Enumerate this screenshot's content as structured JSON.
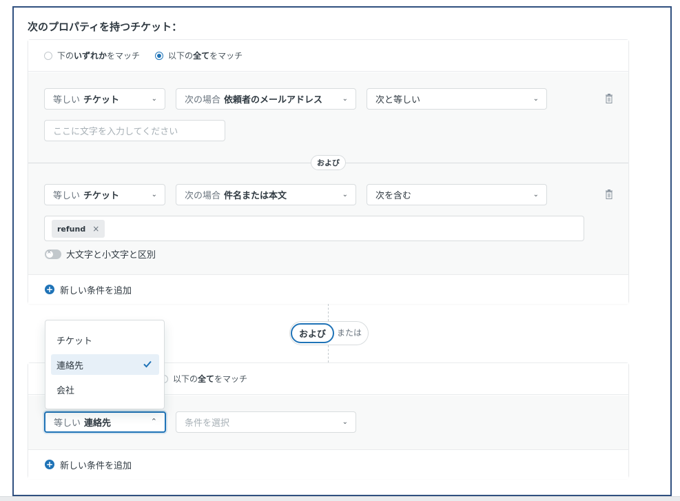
{
  "title": "次のプロパティを持つチケット：",
  "match": {
    "any_prefix": "下の",
    "any_bold": "いずれか",
    "any_suffix": "をマッチ",
    "all_prefix": "以下の",
    "all_bold": "全て",
    "all_suffix": "をマッチ",
    "selected": "all"
  },
  "group1": {
    "conditions": [
      {
        "type_prefix": "等しい",
        "type_value": "チケット",
        "field_prefix": "次の場合",
        "field_value": "依頼者のメールアドレス",
        "operator": "次と等しい",
        "input_placeholder": "ここに文字を入力してください"
      },
      {
        "type_prefix": "等しい",
        "type_value": "チケット",
        "field_prefix": "次の場合",
        "field_value": "件名または本文",
        "operator": "次を含む",
        "tags": [
          "refund"
        ],
        "case_toggle_label": "大文字と小文字と区別",
        "case_toggle_on": false
      }
    ],
    "joiner": "および",
    "add_condition": "新しい条件を追加"
  },
  "group_joiner": {
    "selected": "および",
    "other": "または"
  },
  "dropdown": {
    "items": [
      "チケット",
      "連絡先",
      "会社"
    ],
    "selected": "連絡先"
  },
  "group2": {
    "match_all_prefix": "以下の",
    "match_all_bold": "全て",
    "match_all_suffix": "をマッチ",
    "type_prefix": "等しい",
    "type_value": "連絡先",
    "field_placeholder": "条件を選択",
    "add_condition": "新しい条件を追加"
  },
  "colors": {
    "accent": "#1f73b7",
    "border": "#d8dcde",
    "frame": "#2f4f7f"
  }
}
